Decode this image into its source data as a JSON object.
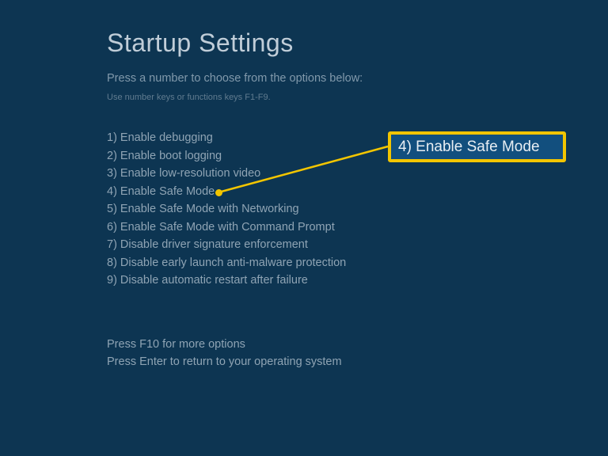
{
  "title": "Startup Settings",
  "subtitle": "Press a number to choose from the options below:",
  "hint": "Use number keys or functions keys F1-F9.",
  "options": [
    "1) Enable debugging",
    "2) Enable boot logging",
    "3) Enable low-resolution video",
    "4) Enable Safe Mode",
    "5) Enable Safe Mode with Networking",
    "6) Enable Safe Mode with Command Prompt",
    "7) Disable driver signature enforcement",
    "8) Disable early launch anti-malware protection",
    "9) Disable automatic restart after failure"
  ],
  "footer": {
    "more_options": "Press F10 for more options",
    "return_text": "Press Enter to return to your operating system"
  },
  "callout": {
    "text": "4) Enable Safe Mode"
  }
}
